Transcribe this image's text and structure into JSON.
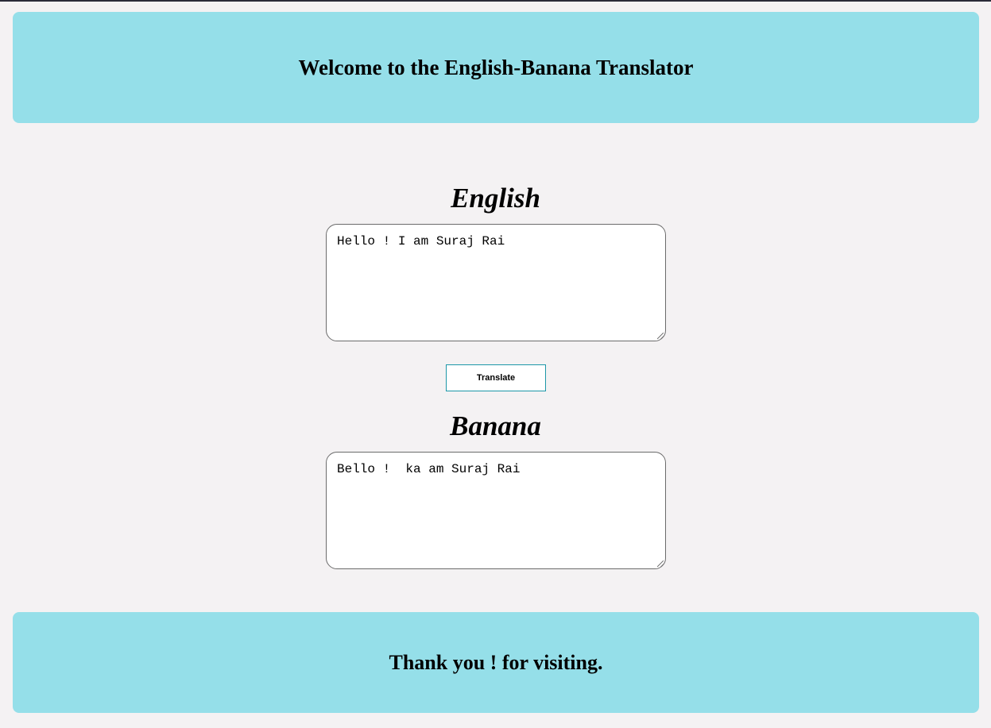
{
  "header": {
    "title": "Welcome to the English-Banana Translator"
  },
  "english": {
    "label": "English",
    "input_value": "Hello ! I am Suraj Rai"
  },
  "translate_button": {
    "label": "Translate"
  },
  "banana": {
    "label": "Banana",
    "output_value": "Bello !  ka am Suraj Rai"
  },
  "footer": {
    "message": "Thank you ! for visiting."
  },
  "colors": {
    "background": "#f4f2f3",
    "banner": "#95dfe9",
    "button_border": "#1c97a8"
  }
}
